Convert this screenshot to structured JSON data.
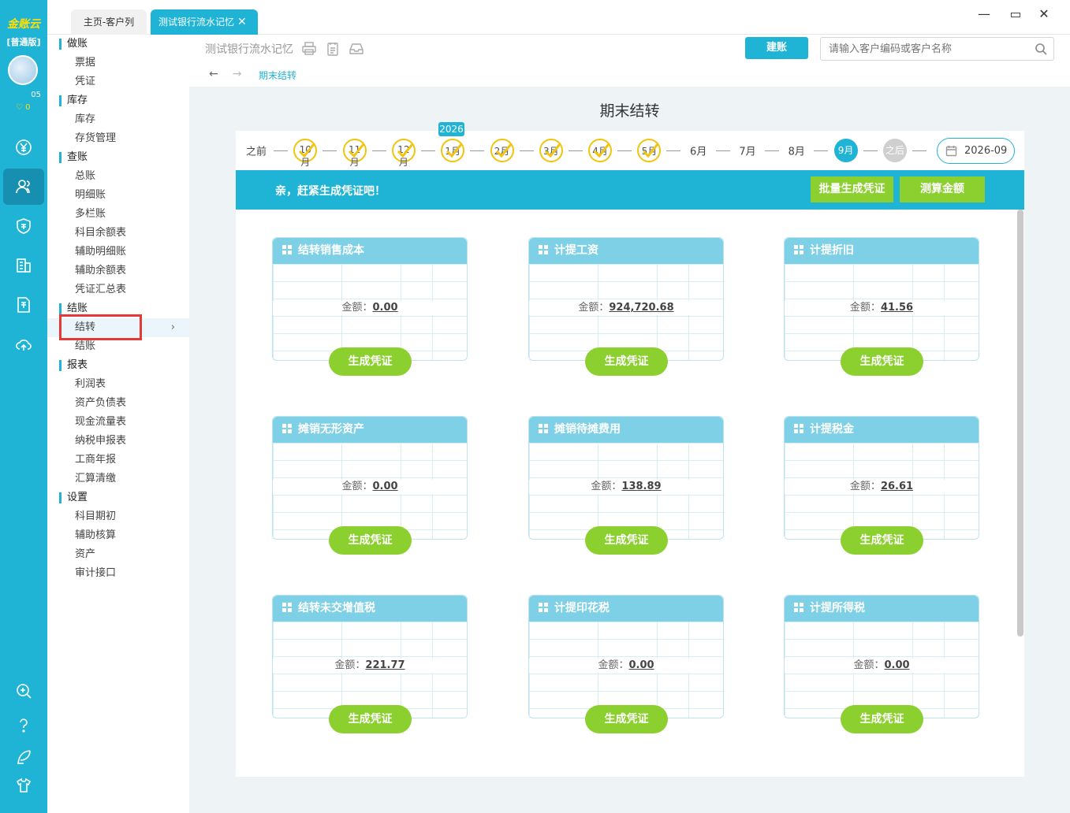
{
  "app": {
    "logo": "金账云",
    "edition": "[普通版]",
    "user_id": "05",
    "coins": "0"
  },
  "rail_icons": [
    "yen-icon",
    "users-icon",
    "tax-shield-icon",
    "building-icon",
    "year-report-icon",
    "cloud-upload-icon",
    "zoom-in-icon",
    "help-icon",
    "quill-icon",
    "shirt-icon"
  ],
  "tabs": {
    "home": "主页-客户列表",
    "current": "测试银行流水记忆"
  },
  "header": {
    "company": "测试银行流水记忆",
    "create_account": "建账",
    "search_placeholder": "请输入客户编码或客户名称",
    "breadcrumb": "期末结转"
  },
  "menu": {
    "groups": [
      {
        "label": "做账",
        "items": [
          "票据",
          "凭证"
        ]
      },
      {
        "label": "库存",
        "items": [
          "库存",
          "存货管理"
        ]
      },
      {
        "label": "查账",
        "items": [
          "总账",
          "明细账",
          "多栏账",
          "科目余额表",
          "辅助明细账",
          "辅助余额表",
          "凭证汇总表"
        ]
      },
      {
        "label": "结账",
        "items": [
          "结转",
          "结账"
        ]
      },
      {
        "label": "报表",
        "items": [
          "利润表",
          "资产负债表",
          "现金流量表",
          "纳税申报表",
          "工商年报",
          "汇算清缴"
        ]
      },
      {
        "label": "设置",
        "items": [
          "科目期初",
          "辅助核算",
          "资产",
          "审计接口"
        ]
      }
    ]
  },
  "page": {
    "title": "期末结转"
  },
  "timeline": {
    "before": "之前",
    "year": "2026",
    "done_months": [
      "10月",
      "11月",
      "12月",
      "1月",
      "2月",
      "3月",
      "4月",
      "5月"
    ],
    "todo_months": [
      "6月",
      "7月",
      "8月"
    ],
    "current": "9月",
    "after": "之后",
    "date": "2026-09"
  },
  "banner": {
    "message": "亲，赶紧生成凭证吧！",
    "batch": "批量生成凭证",
    "calc": "测算金额"
  },
  "cards": [
    {
      "title": "结转销售成本",
      "amount_label": "金额：",
      "amount": "0.00",
      "button": "生成凭证"
    },
    {
      "title": "计提工资",
      "amount_label": "金额：",
      "amount": "924,720.68",
      "button": "生成凭证"
    },
    {
      "title": "计提折旧",
      "amount_label": "金额：",
      "amount": "41.56",
      "button": "生成凭证"
    },
    {
      "title": "摊销无形资产",
      "amount_label": "金额：",
      "amount": "0.00",
      "button": "生成凭证"
    },
    {
      "title": "摊销待摊费用",
      "amount_label": "金额：",
      "amount": "138.89",
      "button": "生成凭证"
    },
    {
      "title": "计提税金",
      "amount_label": "金额：",
      "amount": "26.61",
      "button": "生成凭证"
    },
    {
      "title": "结转未交增值税",
      "amount_label": "金额：",
      "amount": "221.77",
      "button": "生成凭证"
    },
    {
      "title": "计提印花税",
      "amount_label": "金额：",
      "amount": "0.00",
      "button": "生成凭证"
    },
    {
      "title": "计提所得税",
      "amount_label": "金额：",
      "amount": "0.00",
      "button": "生成凭证"
    }
  ],
  "colors": {
    "accent": "#1fb3d6",
    "green": "#8cd02f",
    "check": "#f1c40f",
    "highlight": "#e53935"
  }
}
